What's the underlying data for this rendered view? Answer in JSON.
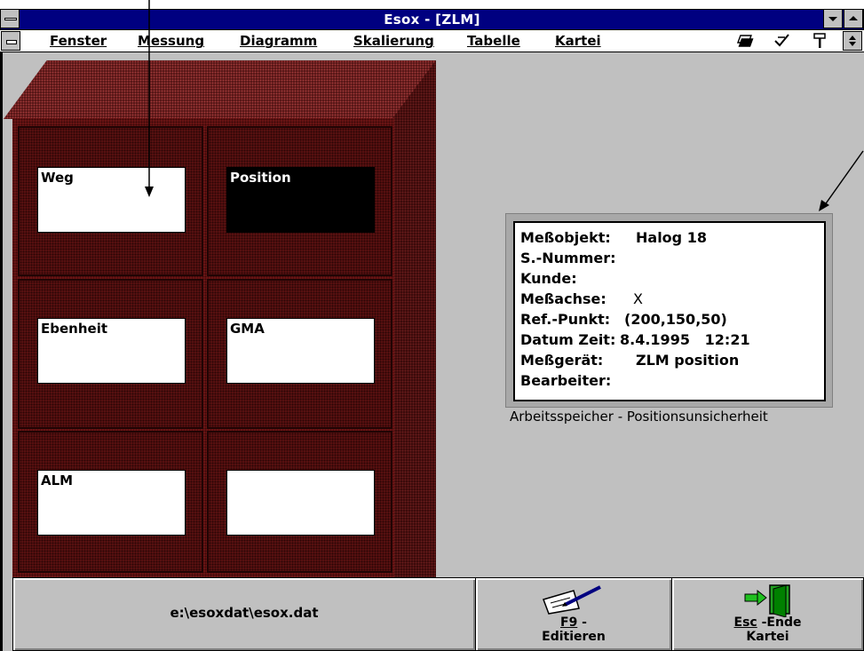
{
  "window": {
    "title": "Esox - [ZLM]"
  },
  "menu": {
    "items": [
      {
        "label": "Fenster"
      },
      {
        "label": "Messung"
      },
      {
        "label": "Diagramm"
      },
      {
        "label": "Skalierung"
      },
      {
        "label": "Tabelle"
      },
      {
        "label": "Kartei"
      }
    ]
  },
  "cabinet": {
    "drawers": [
      {
        "label": "Weg",
        "selected": false
      },
      {
        "label": "Position",
        "selected": true
      },
      {
        "label": "Ebenheit",
        "selected": false
      },
      {
        "label": "GMA",
        "selected": false
      },
      {
        "label": "ALM",
        "selected": false
      },
      {
        "label": "",
        "selected": false
      }
    ]
  },
  "info": {
    "rows": [
      {
        "label": "Meßobjekt:",
        "value": "Halog 18"
      },
      {
        "label": "S.-Nummer:",
        "value": ""
      },
      {
        "label": "Kunde:",
        "value": ""
      },
      {
        "label": "Meßachse:",
        "value": "X"
      },
      {
        "label": "Ref.-Punkt:",
        "value": "(200,150,50)"
      },
      {
        "label": "Datum Zeit:",
        "value": "8.4.1995   12:21"
      },
      {
        "label": "Meßgerät:",
        "value": "ZLM position"
      },
      {
        "label": "Bearbeiter:",
        "value": ""
      }
    ],
    "caption": "Arbeitsspeicher - Positionsunsicherheit"
  },
  "statusbar": {
    "file_path": "e:\\esoxdat\\esox.dat",
    "edit_key": "F9",
    "edit_suffix": " -",
    "edit_label": "Editieren",
    "exit_key": "Esc",
    "exit_suffix": " -Ende",
    "exit_label": "Kartei"
  },
  "colors": {
    "titlebar": "#000080",
    "cabinet": "#6a1414",
    "background": "#c0c0c0"
  }
}
